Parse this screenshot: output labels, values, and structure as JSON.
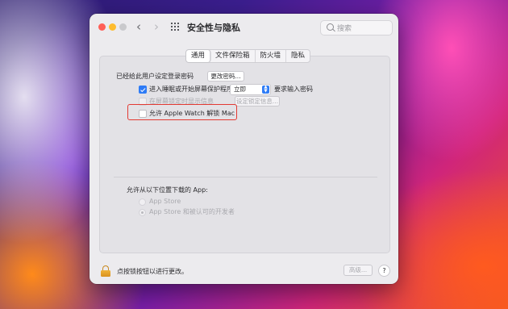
{
  "window": {
    "title": "安全性与隐私",
    "search_placeholder": "搜索",
    "nav_back": "‹",
    "nav_forward": "›"
  },
  "tabs": [
    {
      "label": "通用",
      "active": true
    },
    {
      "label": "文件保险箱",
      "active": false
    },
    {
      "label": "防火墙",
      "active": false
    },
    {
      "label": "隐私",
      "active": false
    }
  ],
  "general": {
    "password_set_label": "已经给此用户设定登录密码",
    "change_password_button": "更改密码...",
    "sleep_password": {
      "label": "进入睡眠或开始屏幕保护程序",
      "checked": true,
      "delay_value": "立即",
      "suffix": "要求输入密码"
    },
    "lock_message": {
      "label": "在屏幕锁定时显示信息",
      "checked": false,
      "enabled": false,
      "button": "设定锁定信息..."
    },
    "apple_watch": {
      "label": "允许 Apple Watch 解锁 Mac",
      "checked": false
    },
    "allow_apps": {
      "heading": "允许从以下位置下载的 App:",
      "options": [
        {
          "label": "App Store",
          "selected": false
        },
        {
          "label": "App Store 和被认可的开发者",
          "selected": true
        }
      ]
    }
  },
  "footer": {
    "lock_text": "点按锁按钮以进行更改。",
    "advanced_button": "高级...",
    "help_button": "?"
  },
  "colors": {
    "accent": "#2f7cf6",
    "highlight_box": "#e33a33"
  }
}
